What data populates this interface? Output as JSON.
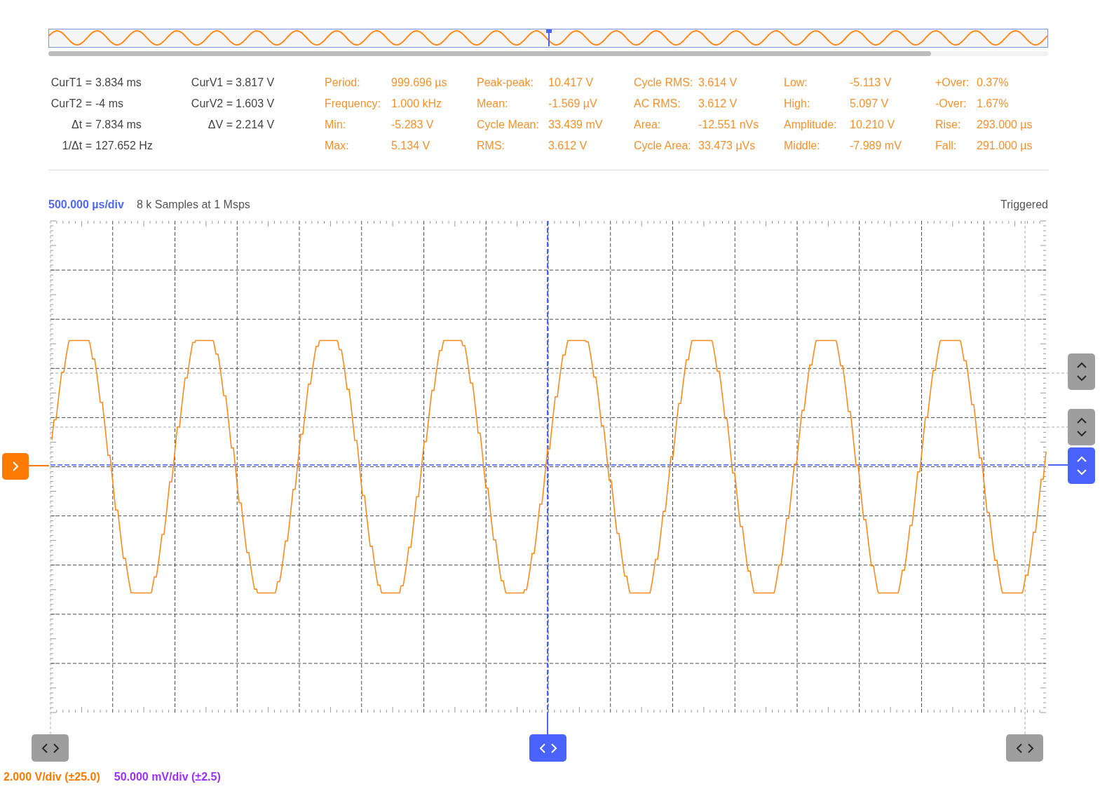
{
  "cursor_readouts": [
    [
      {
        "label": "CurT1 =",
        "value": "3.834 ms"
      },
      {
        "label": "CurT2 =",
        "value": "-4 ms"
      },
      {
        "label": "Δt =",
        "value": "7.834 ms"
      },
      {
        "label": "1/Δt =",
        "value": "127.652 Hz"
      }
    ],
    [
      {
        "label": "CurV1 =",
        "value": "3.817 V"
      },
      {
        "label": "CurV2 =",
        "value": "1.603 V"
      },
      {
        "label": "ΔV =",
        "value": "2.214 V"
      }
    ]
  ],
  "measurements": [
    [
      {
        "label": "Period:",
        "value": "999.696 µs"
      },
      {
        "label": "Frequency:",
        "value": "1.000 kHz"
      },
      {
        "label": "Min:",
        "value": "-5.283 V"
      },
      {
        "label": "Max:",
        "value": "5.134 V"
      }
    ],
    [
      {
        "label": "Peak-peak:",
        "value": "10.417 V"
      },
      {
        "label": "Mean:",
        "value": "-1.569 µV"
      },
      {
        "label": "Cycle Mean:",
        "value": "33.439 mV"
      },
      {
        "label": "RMS:",
        "value": "3.612 V"
      }
    ],
    [
      {
        "label": "Cycle RMS:",
        "value": "3.614 V"
      },
      {
        "label": "AC RMS:",
        "value": "3.612 V"
      },
      {
        "label": "Area:",
        "value": "-12.551 nVs"
      },
      {
        "label": "Cycle Area:",
        "value": "33.473 µVs"
      }
    ],
    [
      {
        "label": "Low:",
        "value": "-5.113 V"
      },
      {
        "label": "High:",
        "value": "5.097 V"
      },
      {
        "label": "Amplitude:",
        "value": "10.210 V"
      },
      {
        "label": "Middle:",
        "value": "-7.989 mV"
      }
    ],
    [
      {
        "label": "+Over:",
        "value": "0.37%"
      },
      {
        "label": "-Over:",
        "value": "1.67%"
      },
      {
        "label": "Rise:",
        "value": "293.000 µs"
      },
      {
        "label": "Fall:",
        "value": "291.000 µs"
      }
    ]
  ],
  "header": {
    "timebase": "500.000 µs/div",
    "sample_info": "8 k Samples at 1 Msps",
    "trigger_status": "Triggered"
  },
  "level_handles": [
    {
      "kind": "cursor"
    },
    {
      "kind": "cursor"
    },
    {
      "kind": "trigger"
    }
  ],
  "time_handles": [
    {
      "kind": "cursor"
    },
    {
      "kind": "trigger"
    },
    {
      "kind": "cursor"
    }
  ],
  "channels": [
    {
      "scale": "2.000 V/div (±25.0)",
      "color": "#ff7a00"
    },
    {
      "scale": "50.000 mV/div (±2.5)",
      "color": "#9b30ff"
    }
  ]
}
